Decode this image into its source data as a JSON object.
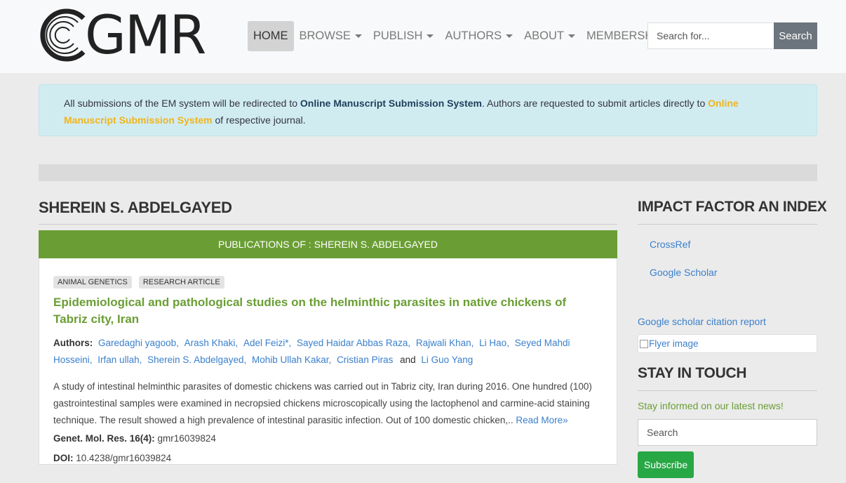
{
  "header": {
    "logo_text": "GMR",
    "nav": [
      {
        "label": "HOME",
        "active": true,
        "dropdown": false
      },
      {
        "label": "BROWSE",
        "active": false,
        "dropdown": true
      },
      {
        "label": "PUBLISH",
        "active": false,
        "dropdown": true
      },
      {
        "label": "AUTHORS",
        "active": false,
        "dropdown": true
      },
      {
        "label": "ABOUT",
        "active": false,
        "dropdown": true
      },
      {
        "label": "MEMBERSHIP",
        "active": false,
        "dropdown": false
      }
    ],
    "search": {
      "placeholder": "Search for...",
      "button": "Search"
    }
  },
  "alert": {
    "part1": "All submissions of the EM system will be redirected to ",
    "link1": "Online Manuscript Submission System",
    "part2": ". Authors are requested to submit articles directly to ",
    "link2": "Online Manuscript Submission System",
    "part3": " of respective journal."
  },
  "main": {
    "author_name": "SHEREIN S. ABDELGAYED",
    "publications_header": "PUBLICATIONS OF : SHEREIN S. ABDELGAYED",
    "article": {
      "badges": [
        "ANIMAL GENETICS",
        "RESEARCH ARTICLE"
      ],
      "title": "Epidemiological and pathological studies on the helminthic parasites in native chickens of Tabriz city, Iran",
      "authors_label": "Authors:",
      "authors": [
        "Garedaghi yagoob,",
        "Arash Khaki,",
        "Adel Feizi*,",
        "Sayed Haidar Abbas Raza,",
        "Rajwali Khan,",
        "Li Hao,",
        "Seyed Mahdi Hosseini,",
        "Irfan ullah,",
        "Sherein S. Abdelgayed,",
        "Mohib Ullah Kakar,",
        "Cristian Piras",
        "and",
        "Li Guo Yang"
      ],
      "abstract": "A study of intestinal helminthic parasites of domestic chickens was carried out in Tabriz city, Iran during 2016. One hundred (100) gastrointestinal samples were examined in necropsied chickens microscopically using the lactophenol and carmine-acid staining technique. The result showed a high prevalence of intestinal parasitic infection. Out of 100 domestic chicken,..",
      "read_more": " Read More»",
      "journal_label": "Genet. Mol. Res. 16(4):",
      "journal_value": " gmr16039824",
      "doi_label": "DOI:",
      "doi_value": " 10.4238/gmr16039824"
    }
  },
  "sidebar": {
    "impact_title": "IMPACT FACTOR AN INDEX",
    "links": [
      "CrossRef",
      "Google Scholar"
    ],
    "gs_report": "Google scholar citation report",
    "flyer_alt": "Flyer image",
    "stay_title": "STAY IN TOUCH",
    "stay_text": "Stay informed on our latest news!",
    "subscribe_placeholder": "Search",
    "subscribe_button": "Subscribe"
  }
}
